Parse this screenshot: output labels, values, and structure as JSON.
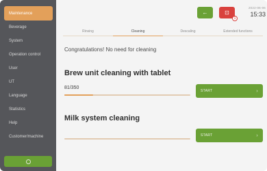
{
  "sidebar": {
    "items": [
      {
        "label": "Maintenance",
        "active": true
      },
      {
        "label": "Beverage",
        "active": false
      },
      {
        "label": "System",
        "active": false
      },
      {
        "label": "Operation control",
        "active": false
      },
      {
        "label": "User",
        "active": false
      },
      {
        "label": "UT",
        "active": false
      },
      {
        "label": "Language",
        "active": false
      },
      {
        "label": "Statistics",
        "active": false
      },
      {
        "label": "Help",
        "active": false
      },
      {
        "label": "Customer/machine",
        "active": false
      }
    ],
    "footer_icon": "power-icon"
  },
  "header": {
    "buttons": [
      {
        "name": "back",
        "icon": "arrow-left-icon",
        "glyph": "←",
        "color": "#6aa135"
      },
      {
        "name": "alerts",
        "icon": "alert-icon",
        "glyph": "⊡",
        "color": "#d9413d",
        "badge": "1"
      }
    ],
    "date": "2022-06-06",
    "time": "15:33"
  },
  "tabs": [
    "Rinsing",
    "Cleaning",
    "Descaling",
    "Extended functions"
  ],
  "active_tab": 1,
  "main": {
    "status_message": "Congratulations! No need for cleaning",
    "brew": {
      "title": "Brew unit cleaning with tablet",
      "counter": "81/350",
      "progress": 0.23,
      "button_label": "START"
    },
    "milk": {
      "title": "Milk system cleaning",
      "progress": 0,
      "button_label": "START"
    }
  },
  "colors": {
    "sidebar_bg": "#55565a",
    "accent_orange": "#e3a05a",
    "action_green": "#6aa135",
    "alert_red": "#d9413d"
  }
}
